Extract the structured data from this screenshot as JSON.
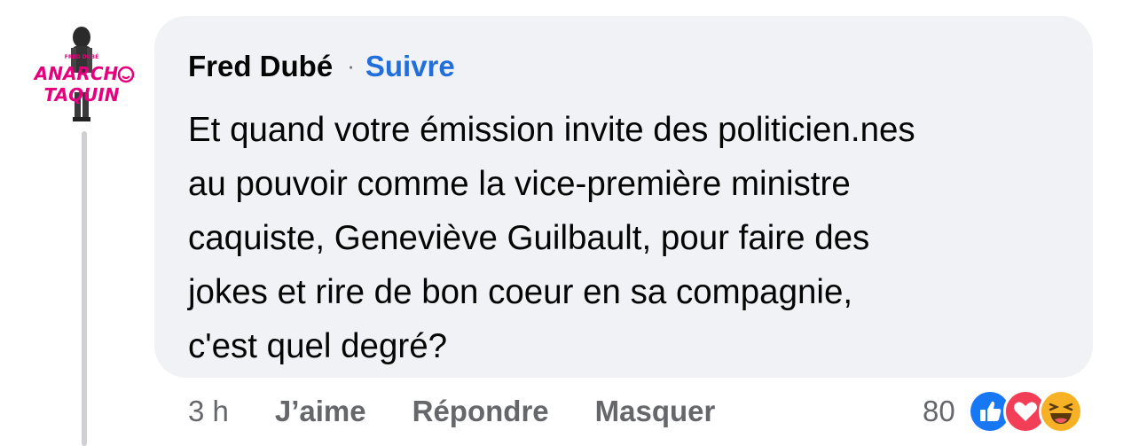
{
  "comment": {
    "author": "Fred Dubé",
    "separator": "·",
    "follow_label": "Suivre",
    "text": "Et quand votre émission invite des politicien.nes\nau pouvoir comme la vice-première ministre\ncaquiste, Geneviève Guilbault, pour faire des\njokes et rire de bon coeur en sa compagnie,\nc'est quel degré?",
    "avatar_text": "FRED DUBÉ ANARCHO TAQUIN"
  },
  "actions": {
    "time": "3 h",
    "like_label": "J’aime",
    "reply_label": "Répondre",
    "hide_label": "Masquer"
  },
  "reactions": {
    "count": "80",
    "icons": [
      "like-icon",
      "love-icon",
      "haha-icon"
    ]
  },
  "colors": {
    "bubble": "#f0f2f5",
    "link": "#216fdb",
    "secondary_text": "#65676b",
    "avatar_accent": "#e6007e"
  }
}
